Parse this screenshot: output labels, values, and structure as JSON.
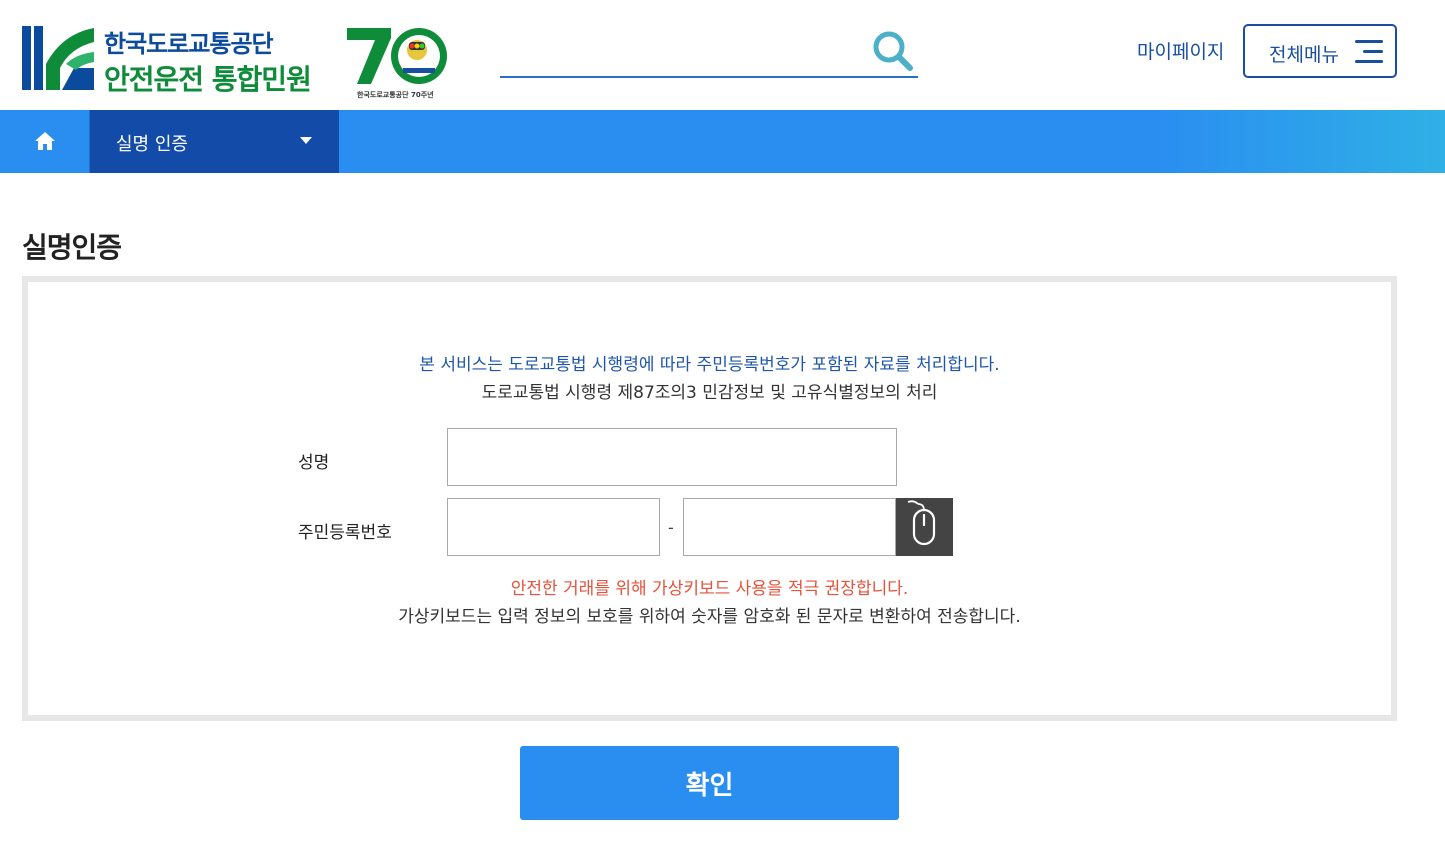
{
  "header": {
    "logo_line1": "한국도로교통공단",
    "logo_line2": "안전운전 통합민원",
    "anniversary_caption": "한국도로교통공단 70주년",
    "search_value": "",
    "mypage_label": "마이페이지",
    "allmenu_label": "전체메뉴"
  },
  "navbar": {
    "current_menu": "실명 인증"
  },
  "page": {
    "title": "실명인증",
    "notice_line1": "본 서비스는 도로교통법 시행령에 따라 주민등록번호가 포함된 자료를 처리합니다.",
    "notice_line2": "도로교통법 시행령 제87조의3 민감정보 및 고유식별정보의 처리",
    "name_label": "성명",
    "name_value": "",
    "rrn_label": "주민등록번호",
    "rrn_front_value": "",
    "rrn_back_value": "",
    "rrn_separator": "-",
    "warning_line1": "안전한 거래를 위해 가상키보드 사용을 적극 권장합니다.",
    "warning_line2": "가상키보드는 입력 정보의 보호를 위하여 숫자를 암호화 된 문자로 변환하여 전송합니다.",
    "confirm_label": "확인"
  },
  "colors": {
    "brand_blue": "#1a4fa0",
    "nav_blue": "#2a8ef0",
    "nav_dark": "#134ba8",
    "brand_green": "#0e8c3a",
    "warning_red": "#e5533b",
    "panel_border": "#e7e7e7"
  },
  "icons": {
    "search": "search-icon",
    "menu": "hamburger-icon",
    "home": "home-icon",
    "dropdown": "caret-down-icon",
    "virtual_keyboard": "mouse-icon"
  }
}
